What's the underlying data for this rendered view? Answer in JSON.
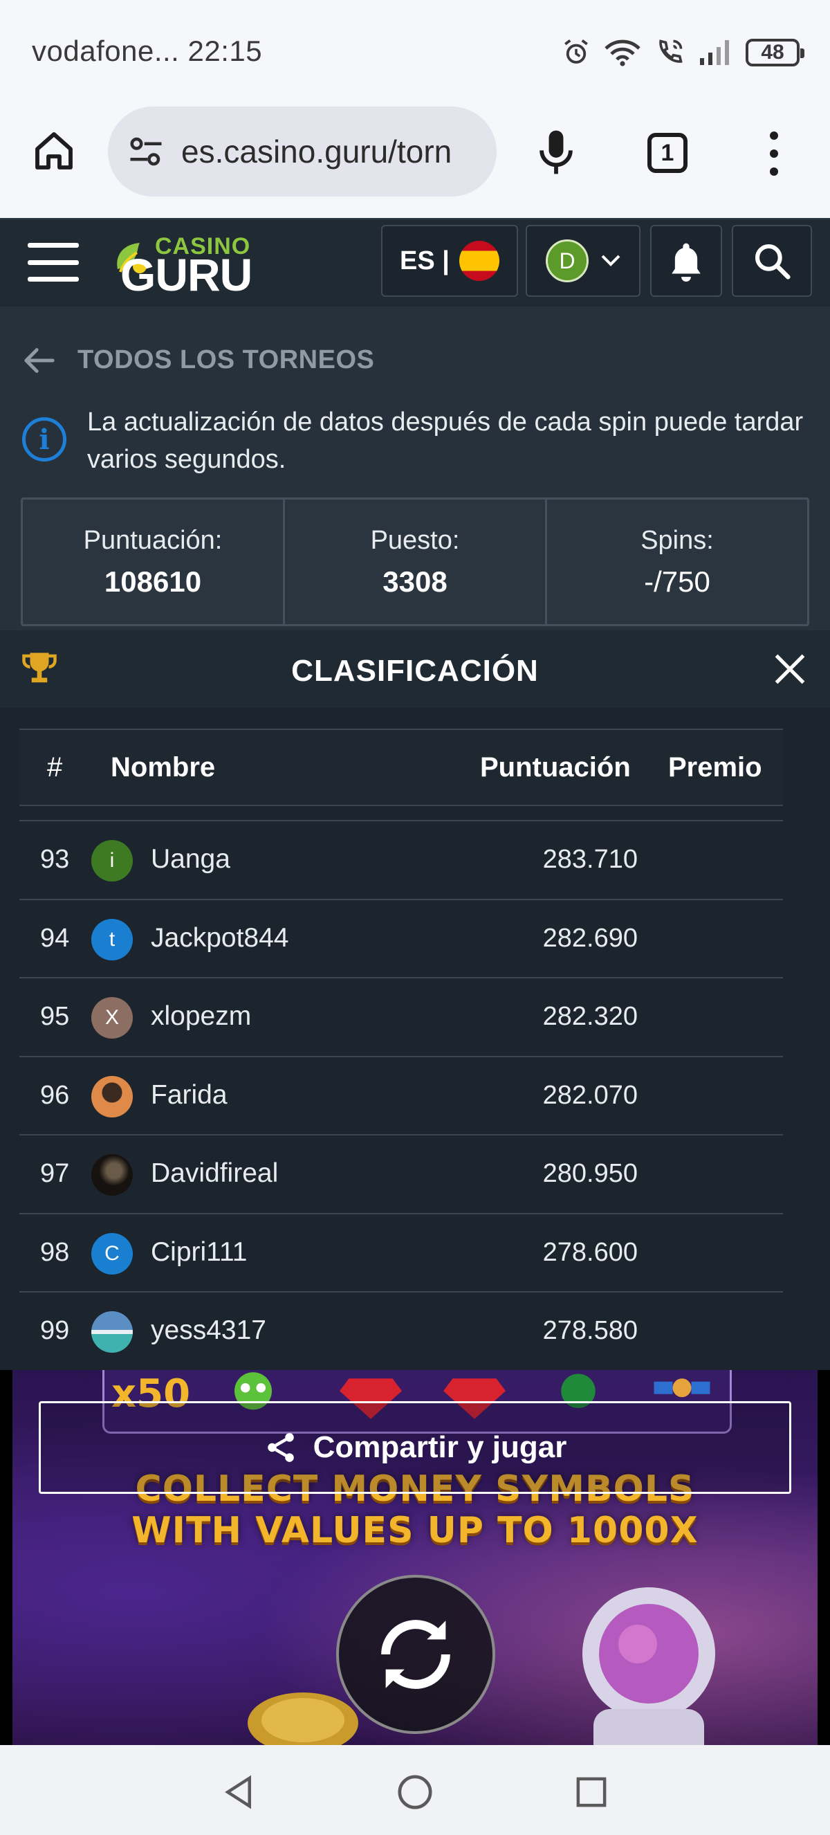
{
  "status_bar": {
    "carrier": "vodafone...",
    "time": "22:15",
    "battery": "48",
    "icons": [
      "alarm-icon",
      "wifi-icon",
      "call-icon",
      "signal-icon",
      "battery-icon"
    ]
  },
  "browser": {
    "url": "es.casino.guru/torn",
    "tab_count": "1",
    "icons": [
      "home-icon",
      "site-settings-icon",
      "mic-icon",
      "tabs-icon",
      "more-vert-icon"
    ]
  },
  "header": {
    "logo_top": "CASINO",
    "logo_bottom": "GURU",
    "language": "ES |",
    "user_initial": "D"
  },
  "page": {
    "back_label": "TODOS LOS TORNEOS",
    "info_text": "La actualización de datos después de cada spin puede tardar varios segundos.",
    "stats": [
      {
        "label": "Puntuación:",
        "value": "108610"
      },
      {
        "label": "Puesto:",
        "value": "3308"
      },
      {
        "label": "Spins:",
        "value": "-/750"
      }
    ],
    "leaderboard_title": "CLASIFICACIÓN"
  },
  "table": {
    "headers": {
      "num": "#",
      "name": "Nombre",
      "score": "Puntuación",
      "prize": "Premio"
    },
    "rows": [
      {
        "rank": "93",
        "initial": "i",
        "name": "Uanga",
        "score": "283.710",
        "avatar_color": "#3d7a22"
      },
      {
        "rank": "94",
        "initial": "t",
        "name": "Jackpot844",
        "score": "282.690",
        "avatar_color": "#1a7fd1"
      },
      {
        "rank": "95",
        "initial": "X",
        "name": "xlopezm",
        "score": "282.320",
        "avatar_color": "#8d6e63"
      },
      {
        "rank": "96",
        "initial": "",
        "name": "Farida",
        "score": "282.070",
        "avatar_color": "#e08a4a"
      },
      {
        "rank": "97",
        "initial": "",
        "name": "Davidfireal",
        "score": "280.950",
        "avatar_color": "#2a2520"
      },
      {
        "rank": "98",
        "initial": "C",
        "name": "Cipri111",
        "score": "278.600",
        "avatar_color": "#1a7fd1"
      },
      {
        "rank": "99",
        "initial": "",
        "name": "yess4317",
        "score": "278.580",
        "avatar_color": "#5aa6c9"
      }
    ]
  },
  "game": {
    "promo_line1": "COLLECT MONEY SYMBOLS",
    "promo_line2": "WITH VALUES UP TO 1000X",
    "reel_multiplier": "x50",
    "share_button": "Compartir y jugar"
  },
  "colors": {
    "accent_blue": "#1e7fd9",
    "logo_green": "#8dc63f",
    "header_bg": "#1f2a33",
    "panel_bg": "#27313b"
  }
}
